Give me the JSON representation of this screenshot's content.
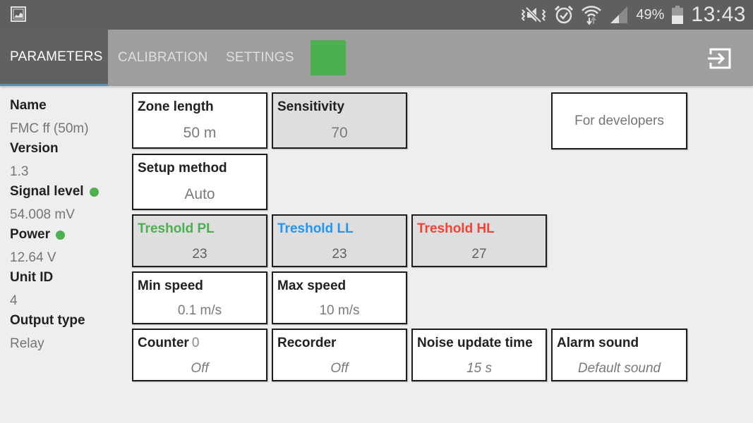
{
  "status_bar": {
    "icons": [
      "gallery-icon",
      "mute-vibrate-icon",
      "alarm-icon",
      "wifi-icon",
      "signal-icon",
      "battery-icon"
    ],
    "battery_percent": "49%",
    "time": "13:43"
  },
  "tabs": [
    {
      "label": "PARAMETERS",
      "active": true
    },
    {
      "label": "CALIBRATION",
      "active": false
    },
    {
      "label": "SETTINGS",
      "active": false
    }
  ],
  "status_indicator_color": "#4caf50",
  "exit_icon": "exit-to-app-icon",
  "info": {
    "name_label": "Name",
    "name_value": "FMC ff (50m)",
    "version_label": "Version",
    "version_value": "1.3",
    "signal_label": "Signal level",
    "signal_value": "54.008 mV",
    "signal_status_color": "#4caf50",
    "power_label": "Power",
    "power_value": "12.64 V",
    "power_status_color": "#4caf50",
    "unit_label": "Unit ID",
    "unit_value": "4",
    "output_label": "Output type",
    "output_value": "Relay"
  },
  "cards": {
    "zone_length": {
      "title": "Zone length",
      "value": "50 m"
    },
    "sensitivity": {
      "title": "Sensitivity",
      "value": "70"
    },
    "setup_method": {
      "title": "Setup method",
      "value": "Auto"
    },
    "for_developers": {
      "label": "For developers"
    },
    "treshold_pl": {
      "title": "Treshold PL",
      "value": "23",
      "color": "#4caf50"
    },
    "treshold_ll": {
      "title": "Treshold LL",
      "value": "23",
      "color": "#2196f3"
    },
    "treshold_hl": {
      "title": "Treshold HL",
      "value": "27",
      "color": "#f44336"
    },
    "min_speed": {
      "title": "Min speed",
      "value": "0.1 m/s"
    },
    "max_speed": {
      "title": "Max speed",
      "value": "10 m/s"
    },
    "counter": {
      "title": "Counter",
      "count": "0",
      "value": "Off"
    },
    "recorder": {
      "title": "Recorder",
      "value": "Off"
    },
    "noise_update": {
      "title": "Noise update time",
      "value": "15 s"
    },
    "alarm_sound": {
      "title": "Alarm sound",
      "value": "Default sound"
    }
  }
}
